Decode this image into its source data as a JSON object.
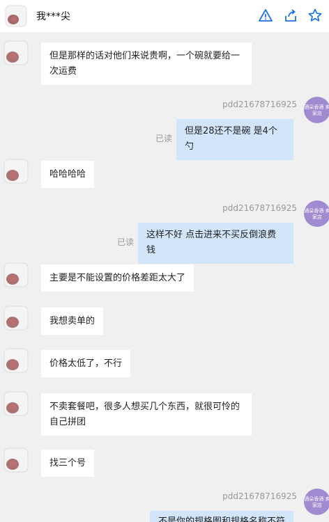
{
  "header": {
    "title": "我***尖",
    "icons": [
      "alert-icon",
      "share-icon",
      "star-icon"
    ],
    "accent_color": "#1a73e8"
  },
  "messages": [
    {
      "side": "left",
      "text": "但是那样的话对他们来说贵啊，一个碗就要给一次运费"
    },
    {
      "side": "right",
      "sender": "pdd21678716925",
      "status": "已读",
      "text": "但是28还不是碗 是4个勺"
    },
    {
      "side": "left",
      "text": "哈哈哈哈"
    },
    {
      "side": "right",
      "sender": "pdd21678716925",
      "status": "已读",
      "text": "这样不好 点击进来不买反倒浪费钱"
    },
    {
      "side": "left",
      "text": "主要是不能设置的价格差距太大了"
    },
    {
      "side": "left",
      "text": "我想卖单的"
    },
    {
      "side": "left",
      "text": "价格太低了，不行"
    },
    {
      "side": "left",
      "text": "不卖套餐吧，很多人想买几个东西，就很可怜的自己拼团"
    },
    {
      "side": "left",
      "text": "找三个号"
    },
    {
      "side": "right",
      "sender": "pdd21678716925",
      "status": "",
      "text": "不是你的规格图和规格名称不符"
    }
  ],
  "seller_avatar": {
    "label": "酒朵香酒 卖家店"
  },
  "colors": {
    "background": "#f0f0f0",
    "bubble_left": "#ffffff",
    "bubble_right": "#d2e5fb",
    "seller_avatar": "#a08ad0"
  }
}
